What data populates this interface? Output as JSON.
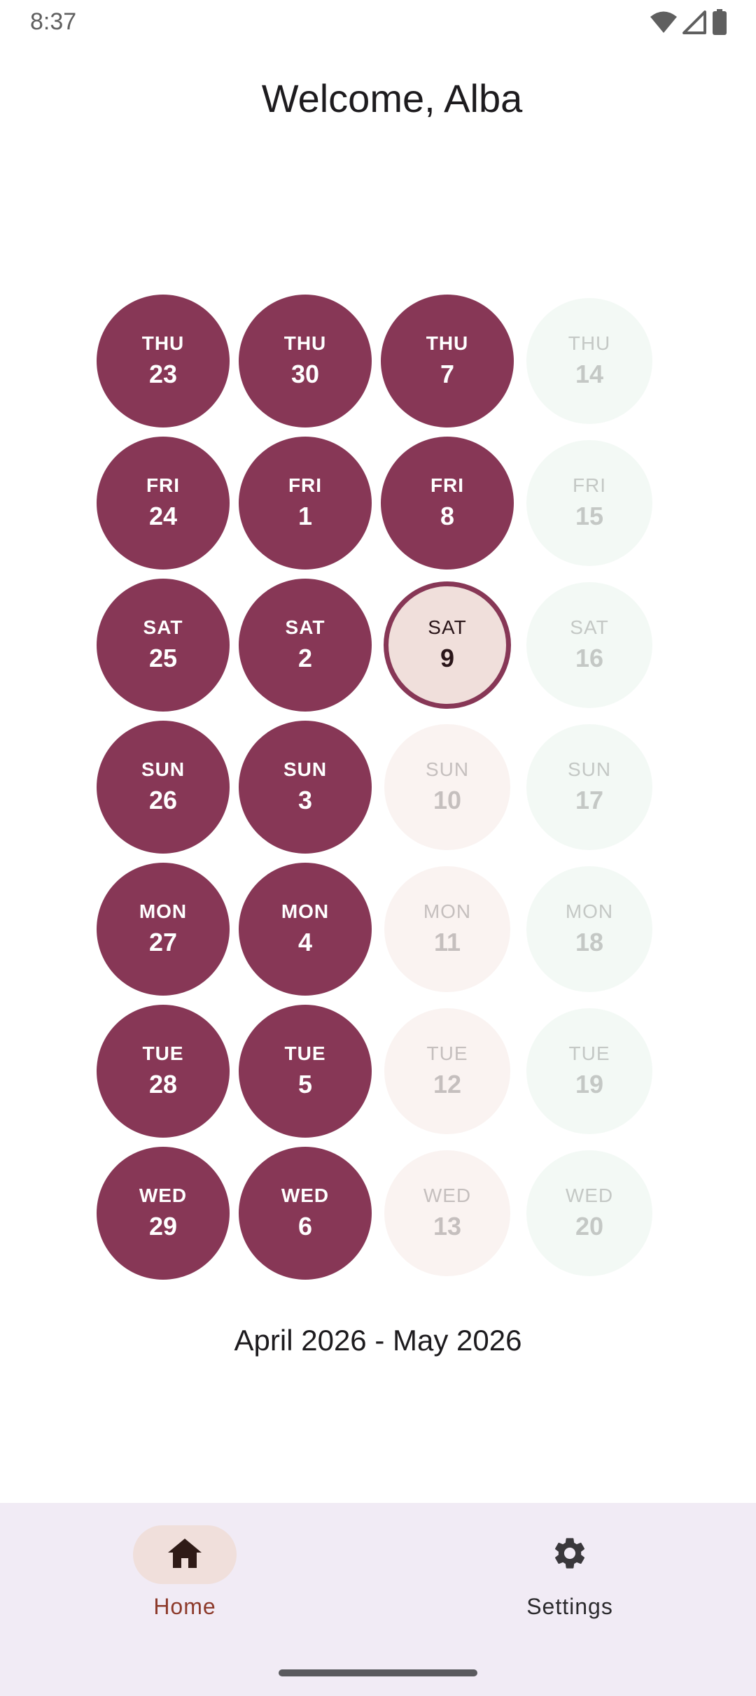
{
  "status_bar": {
    "time": "8:37",
    "icons": [
      "wifi-icon",
      "cell-signal-icon",
      "battery-icon"
    ]
  },
  "header": {
    "welcome": "Welcome, Alba"
  },
  "calendar": {
    "range_label": "April 2026 - May 2026",
    "colors": {
      "past": "#873756",
      "today_fill": "#f0dfdb",
      "today_border": "#873756",
      "future_week3": "#faf3f1",
      "future_week4": "#f3f9f5"
    },
    "weeks": [
      {
        "days": [
          {
            "dow": "THU",
            "num": "23",
            "state": "past"
          },
          {
            "dow": "FRI",
            "num": "24",
            "state": "past"
          },
          {
            "dow": "SAT",
            "num": "25",
            "state": "past"
          },
          {
            "dow": "SUN",
            "num": "26",
            "state": "past"
          },
          {
            "dow": "MON",
            "num": "27",
            "state": "past"
          },
          {
            "dow": "TUE",
            "num": "28",
            "state": "past"
          },
          {
            "dow": "WED",
            "num": "29",
            "state": "past"
          }
        ]
      },
      {
        "days": [
          {
            "dow": "THU",
            "num": "30",
            "state": "past"
          },
          {
            "dow": "FRI",
            "num": "1",
            "state": "past"
          },
          {
            "dow": "SAT",
            "num": "2",
            "state": "past"
          },
          {
            "dow": "SUN",
            "num": "3",
            "state": "past"
          },
          {
            "dow": "MON",
            "num": "4",
            "state": "past"
          },
          {
            "dow": "TUE",
            "num": "5",
            "state": "past"
          },
          {
            "dow": "WED",
            "num": "6",
            "state": "past"
          }
        ]
      },
      {
        "days": [
          {
            "dow": "THU",
            "num": "7",
            "state": "past"
          },
          {
            "dow": "FRI",
            "num": "8",
            "state": "past"
          },
          {
            "dow": "SAT",
            "num": "9",
            "state": "today"
          },
          {
            "dow": "SUN",
            "num": "10",
            "state": "future-a"
          },
          {
            "dow": "MON",
            "num": "11",
            "state": "future-a"
          },
          {
            "dow": "TUE",
            "num": "12",
            "state": "future-a"
          },
          {
            "dow": "WED",
            "num": "13",
            "state": "future-a"
          }
        ]
      },
      {
        "days": [
          {
            "dow": "THU",
            "num": "14",
            "state": "future-b"
          },
          {
            "dow": "FRI",
            "num": "15",
            "state": "future-b"
          },
          {
            "dow": "SAT",
            "num": "16",
            "state": "future-b"
          },
          {
            "dow": "SUN",
            "num": "17",
            "state": "future-b"
          },
          {
            "dow": "MON",
            "num": "18",
            "state": "future-b"
          },
          {
            "dow": "TUE",
            "num": "19",
            "state": "future-b"
          },
          {
            "dow": "WED",
            "num": "20",
            "state": "future-b"
          }
        ]
      }
    ]
  },
  "bottom_nav": {
    "items": [
      {
        "label": "Home",
        "icon": "home-icon",
        "selected": true
      },
      {
        "label": "Settings",
        "icon": "gear-icon",
        "selected": false
      }
    ]
  }
}
